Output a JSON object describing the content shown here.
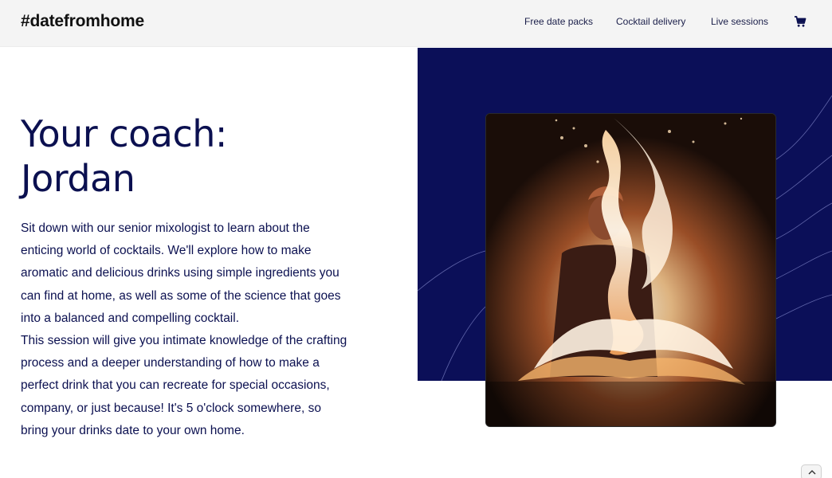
{
  "header": {
    "logo": "#datefromhome",
    "nav": [
      {
        "label": "Free date packs"
      },
      {
        "label": "Cocktail delivery"
      },
      {
        "label": "Live sessions"
      }
    ],
    "cart_icon": "shopping-cart-icon"
  },
  "main": {
    "title_line1": "Your coach:",
    "title_line2": "Jordan",
    "paragraph1": "Sit down with our senior mixologist to learn about the enticing world of cocktails. We'll explore how to make aromatic and delicious drinks using simple ingredients you can find at home, as well as some of the science that goes into a balanced and compelling cocktail.",
    "paragraph2": "This session will give you intimate knowledge of the crafting process and a deeper understanding of how to make a perfect drink that you can recreate for special occasions, company, or just because! It's 5 o'clock somewhere, so bring your drinks date to your own home.",
    "photo_icon": "coach-photo-flames"
  },
  "colors": {
    "navy": "#0b0f58",
    "text": "#0b1050",
    "header_bg": "#f4f4f4"
  },
  "scroll_top_icon": "chevron-up-icon"
}
